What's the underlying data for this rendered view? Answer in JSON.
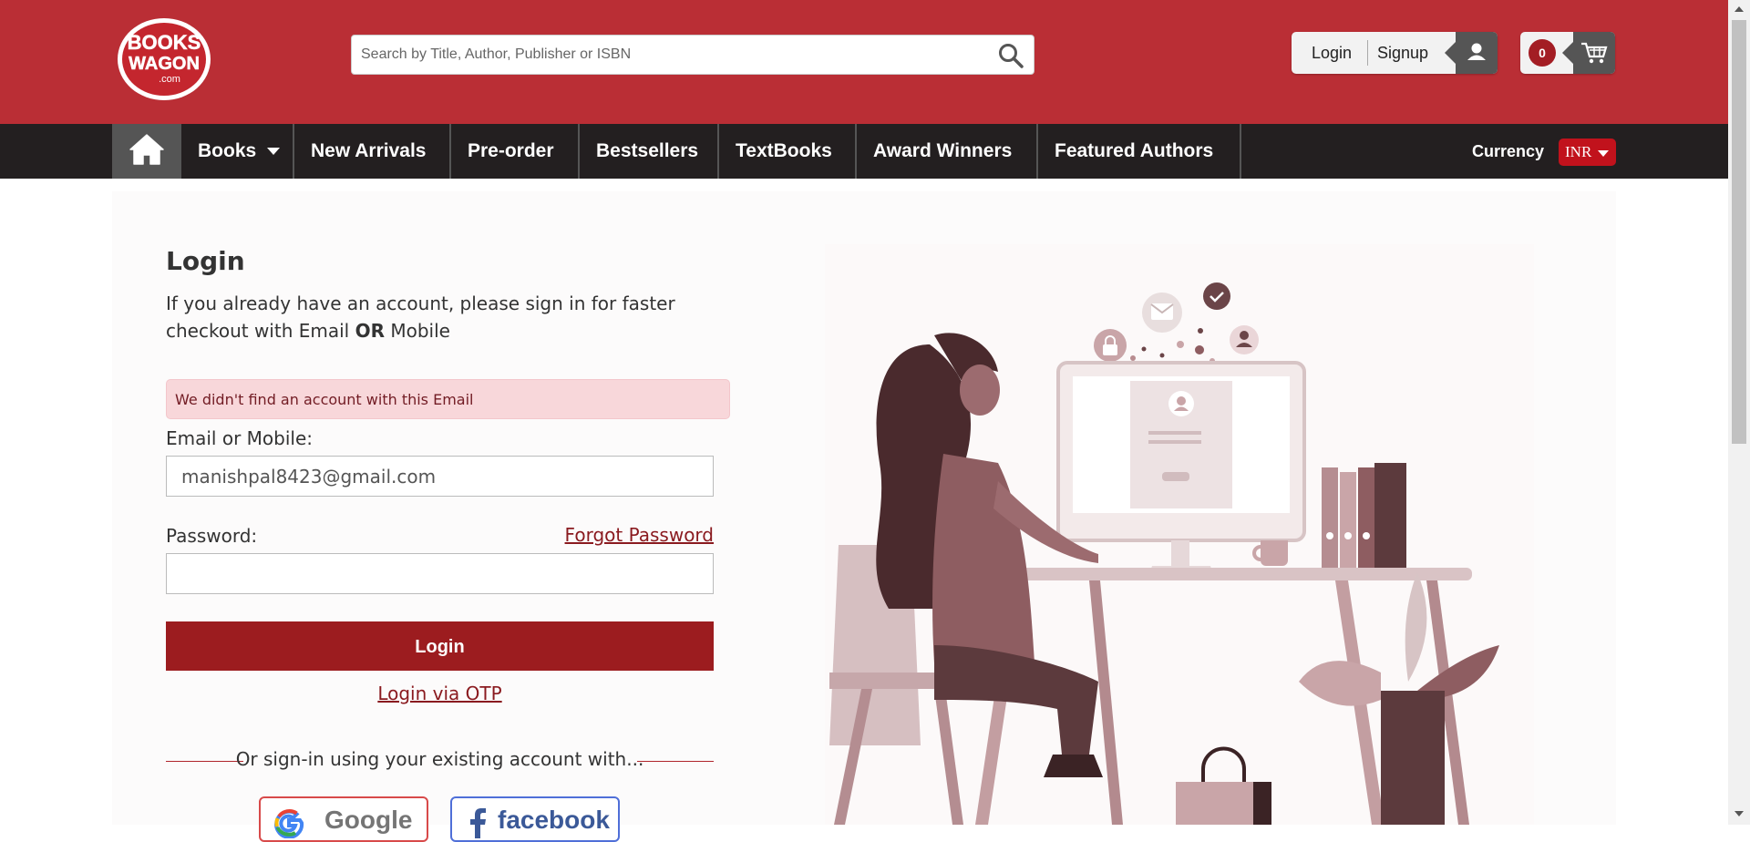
{
  "header": {
    "logo": {
      "lines": [
        "BOOKS",
        "WAGON",
        ".com"
      ]
    },
    "search": {
      "placeholder": "Search by Title, Author, Publisher or ISBN"
    },
    "auth": {
      "login_label": "Login",
      "signup_label": "Signup"
    },
    "cart": {
      "count": "0"
    }
  },
  "nav": {
    "items": [
      {
        "label": "Books"
      },
      {
        "label": "New Arrivals"
      },
      {
        "label": "Pre-order"
      },
      {
        "label": "Bestsellers"
      },
      {
        "label": "TextBooks"
      },
      {
        "label": "Award Winners"
      },
      {
        "label": "Featured Authors"
      }
    ],
    "currency_label": "Currency",
    "currency_value": "INR"
  },
  "login": {
    "title": "Login",
    "intro_part1": "If you already have an account, please sign in for faster checkout with Email ",
    "intro_bold": "OR",
    "intro_part2": " Mobile",
    "error_message": "We didn't find an account with this Email",
    "email_label": "Email or Mobile:",
    "email_value": "manishpal8423@gmail.com",
    "password_label": "Password:",
    "password_value": "",
    "forgot_label": "Forgot Password",
    "login_button": "Login",
    "otp_link": "Login via OTP",
    "divider_text": "Or sign-in using your existing account with...",
    "social": {
      "google": "Google",
      "facebook": "facebook"
    }
  },
  "colors": {
    "header_bg": "#ba2e35",
    "nav_bg": "#231f20",
    "primary_button": "#9c1c1f",
    "error_bg": "#f8d7da",
    "currency_bg": "#c1121c"
  },
  "icons": [
    "search-icon",
    "user-icon",
    "cart-icon",
    "home-icon",
    "chevron-down-icon"
  ]
}
